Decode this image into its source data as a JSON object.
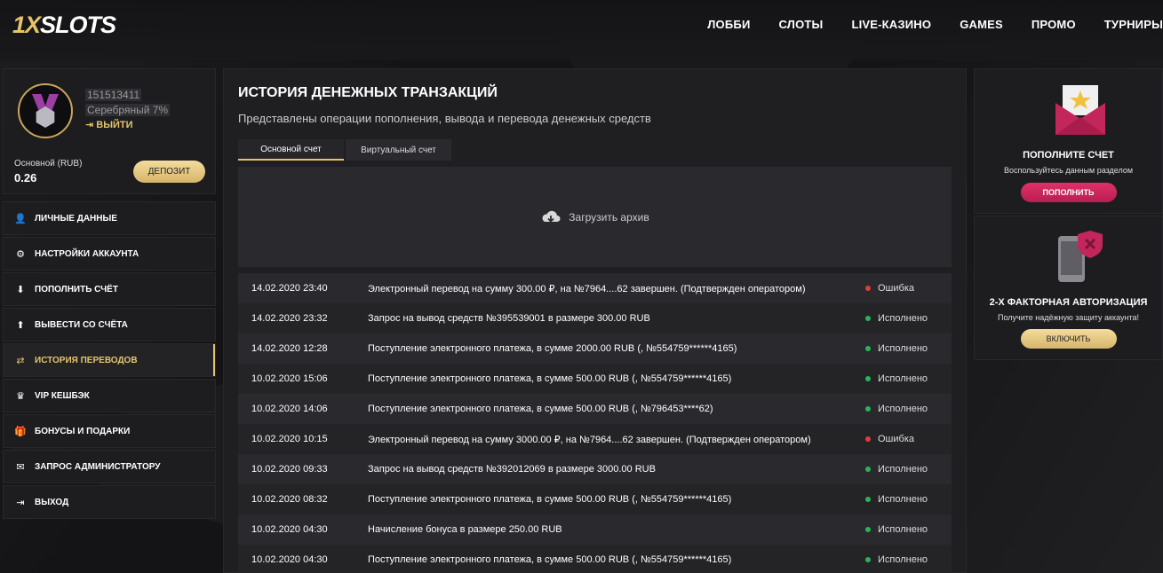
{
  "header": {
    "logo_prefix": "1X",
    "logo_suffix": "SLOTS",
    "nav": [
      "ЛОББИ",
      "СЛОТЫ",
      "LIVE-КАЗИНО",
      "GAMES",
      "ПРОМО",
      "ТУРНИРЫ"
    ]
  },
  "profile": {
    "user_id": "151513411",
    "level": "Серебряный 7%",
    "logout_label": "ВЫЙТИ",
    "account_label": "Основной (RUB)",
    "balance": "0.26",
    "deposit_label": "ДЕПОЗИТ"
  },
  "menu": [
    {
      "label": "ЛИЧНЫЕ ДАННЫЕ",
      "icon": "user-add-icon",
      "glyph": "👤"
    },
    {
      "label": "НАСТРОЙКИ АККАУНТА",
      "icon": "gears-icon",
      "glyph": "⚙"
    },
    {
      "label": "ПОПОЛНИТЬ СЧЁТ",
      "icon": "download-icon",
      "glyph": "⬇"
    },
    {
      "label": "ВЫВЕСТИ СО СЧЁТА",
      "icon": "upload-icon",
      "glyph": "⬆"
    },
    {
      "label": "ИСТОРИЯ ПЕРЕВОДОВ",
      "icon": "transfer-icon",
      "glyph": "⇄",
      "active": true
    },
    {
      "label": "VIP КЕШБЭК",
      "icon": "crown-icon",
      "glyph": "♛"
    },
    {
      "label": "БОНУСЫ И ПОДАРКИ",
      "icon": "gift-icon",
      "glyph": "🎁"
    },
    {
      "label": "ЗАПРОС АДМИНИСТРАТОРУ",
      "icon": "envelope-icon",
      "glyph": "✉"
    },
    {
      "label": "ВЫХОД",
      "icon": "exit-icon",
      "glyph": "⇥"
    }
  ],
  "main": {
    "title": "ИСТОРИЯ ДЕНЕЖНЫХ ТРАНЗАКЦИЙ",
    "subtitle": "Представлены операции пополнения, вывода и перевода денежных средств",
    "tabs": [
      "Основной счет",
      "Виртуальный счет"
    ],
    "archive_label": "Загрузить архив",
    "transactions": [
      {
        "date": "14.02.2020 23:40",
        "desc": "Электронный перевод на сумму 300.00 ₽, на №7964....62 завершен. (Подтвержден оператором)",
        "status": "Ошибка",
        "ok": false
      },
      {
        "date": "14.02.2020 23:32",
        "desc": "Запрос на вывод средств №395539001 в размере 300.00 RUB",
        "status": "Исполнено",
        "ok": true
      },
      {
        "date": "14.02.2020 12:28",
        "desc": "Поступление электронного платежа, в сумме 2000.00 RUB (, №554759******4165)",
        "status": "Исполнено",
        "ok": true
      },
      {
        "date": "10.02.2020 15:06",
        "desc": "Поступление электронного платежа, в сумме 500.00 RUB (, №554759******4165)",
        "status": "Исполнено",
        "ok": true
      },
      {
        "date": "10.02.2020 14:06",
        "desc": "Поступление электронного платежа, в сумме 500.00 RUB (, №796453****62)",
        "status": "Исполнено",
        "ok": true
      },
      {
        "date": "10.02.2020 10:15",
        "desc": "Электронный перевод на сумму 3000.00 ₽, на №7964....62 завершен. (Подтвержден оператором)",
        "status": "Ошибка",
        "ok": false
      },
      {
        "date": "10.02.2020 09:33",
        "desc": "Запрос на вывод средств №392012069 в размере 3000.00 RUB",
        "status": "Исполнено",
        "ok": true
      },
      {
        "date": "10.02.2020 08:32",
        "desc": "Поступление электронного платежа, в сумме 500.00 RUB (, №554759******4165)",
        "status": "Исполнено",
        "ok": true
      },
      {
        "date": "10.02.2020 04:30",
        "desc": "Начисление бонуса в размере 250.00 RUB",
        "status": "Исполнено",
        "ok": true
      },
      {
        "date": "10.02.2020 04:30",
        "desc": "Поступление электронного платежа, в сумме 500.00 RUB (, №554759******4165)",
        "status": "Исполнено",
        "ok": true
      }
    ]
  },
  "right": {
    "promo1": {
      "title": "ПОПОЛНИТЕ СЧЕТ",
      "sub": "Воспользуйтесь данным разделом",
      "button": "ПОПОЛНИТЬ"
    },
    "promo2": {
      "title": "2-Х ФАКТОРНАЯ АВТОРИЗАЦИЯ",
      "sub": "Получите надёжную защиту аккаунта!",
      "button": "ВКЛЮЧИТЬ"
    }
  },
  "colors": {
    "accent": "#e6c46c",
    "error": "#e63b3b",
    "success": "#2bb35a",
    "pink": "#d82a62"
  }
}
